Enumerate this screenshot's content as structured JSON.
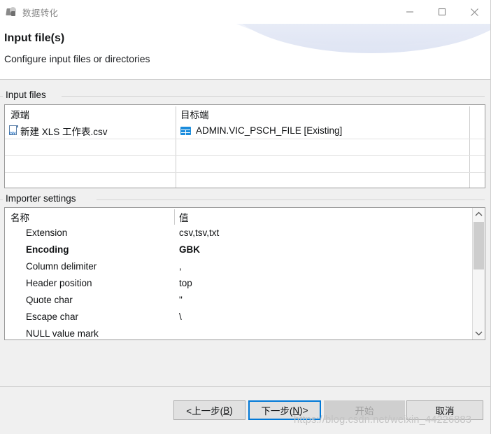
{
  "window": {
    "title": "数据转化",
    "icon": "app-icon",
    "controls": {
      "minimize": "minimize-icon",
      "maximize": "maximize-icon",
      "close": "close-icon"
    }
  },
  "header": {
    "title": "Input file(s)",
    "subtitle": "Configure input files or directories"
  },
  "input_files": {
    "group_label": "Input files",
    "columns": [
      "源端",
      "目标端"
    ],
    "rows": [
      {
        "source_icon": "csv-file-icon",
        "source": "新建 XLS 工作表.csv",
        "target_icon": "database-table-icon",
        "target": "ADMIN.VIC_PSCH_FILE [Existing]"
      }
    ]
  },
  "importer_settings": {
    "group_label": "Importer settings",
    "columns": [
      "名称",
      "值"
    ],
    "rows": [
      {
        "name": "Extension",
        "value": "csv,tsv,txt",
        "bold": false
      },
      {
        "name": "Encoding",
        "value": "GBK",
        "bold": true
      },
      {
        "name": "Column delimiter",
        "value": ",",
        "bold": false
      },
      {
        "name": "Header position",
        "value": "top",
        "bold": false
      },
      {
        "name": "Quote char",
        "value": "\"",
        "bold": false
      },
      {
        "name": "Escape char",
        "value": "\\",
        "bold": false
      },
      {
        "name": "NULL value mark",
        "value": "",
        "bold": false
      }
    ],
    "scrollbar": {
      "up": "chevron-up-icon",
      "down": "chevron-down-icon"
    }
  },
  "buttons": {
    "back": "<上一步(B)",
    "back_plain": "<上一步(",
    "back_mnemonic": "B",
    "back_tail": ")",
    "next_plain": "下一步(",
    "next_mnemonic": "N",
    "next_tail": ")>",
    "start": "开始",
    "cancel": "取消"
  },
  "watermark": "https://blog.csdn.net/weixin_44226883",
  "colors": {
    "accent": "#0078d7",
    "table_icon": "#1b8cdc",
    "csv_icon": "#1267c0",
    "body_bg": "#f0f0f0"
  }
}
